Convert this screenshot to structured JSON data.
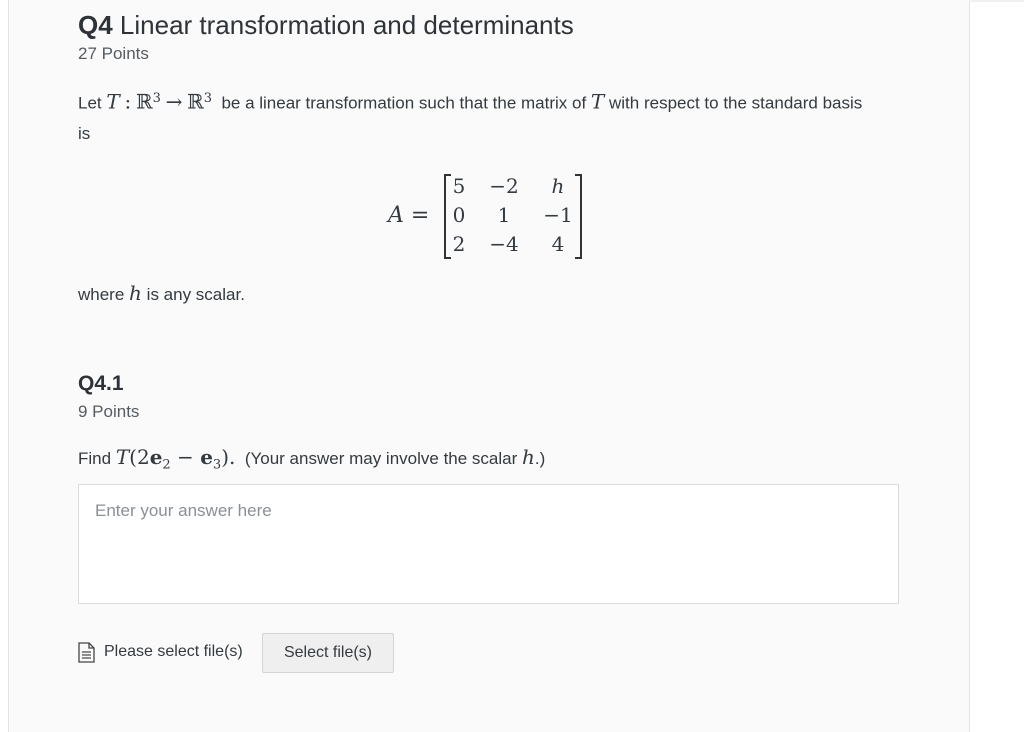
{
  "question": {
    "number": "Q4",
    "title": "Linear transformation and determinants",
    "points": "27 Points",
    "prompt": {
      "let": "Let",
      "map_T": "T",
      "colon": ":",
      "R": "ℝ",
      "exp": "3",
      "arrow": "→",
      "after_map": "be a linear transformation such that the matrix of",
      "T": "T",
      "after_T": "with respect to the standard basis is"
    },
    "matrix": {
      "label": "A =",
      "rows": [
        [
          "5",
          "−2",
          "h"
        ],
        [
          "0",
          "1",
          "−1"
        ],
        [
          "2",
          "−4",
          "4"
        ]
      ]
    },
    "where": {
      "before": "where",
      "var": "h",
      "after": "is any scalar."
    }
  },
  "subquestion": {
    "number": "Q4.1",
    "points": "9 Points",
    "prompt": {
      "find": "Find",
      "T": "T",
      "open": "(2",
      "e": "e",
      "sub2": "2",
      "minus": " − ",
      "sub3": "3",
      "close": ").",
      "note_before": "(Your answer may involve the scalar",
      "h": "h",
      "note_after": ".)"
    },
    "answer_placeholder": "Enter your answer here",
    "file_label": "Please select file(s)",
    "file_button": "Select file(s)",
    "icons": {
      "file": "file-document-icon"
    }
  }
}
